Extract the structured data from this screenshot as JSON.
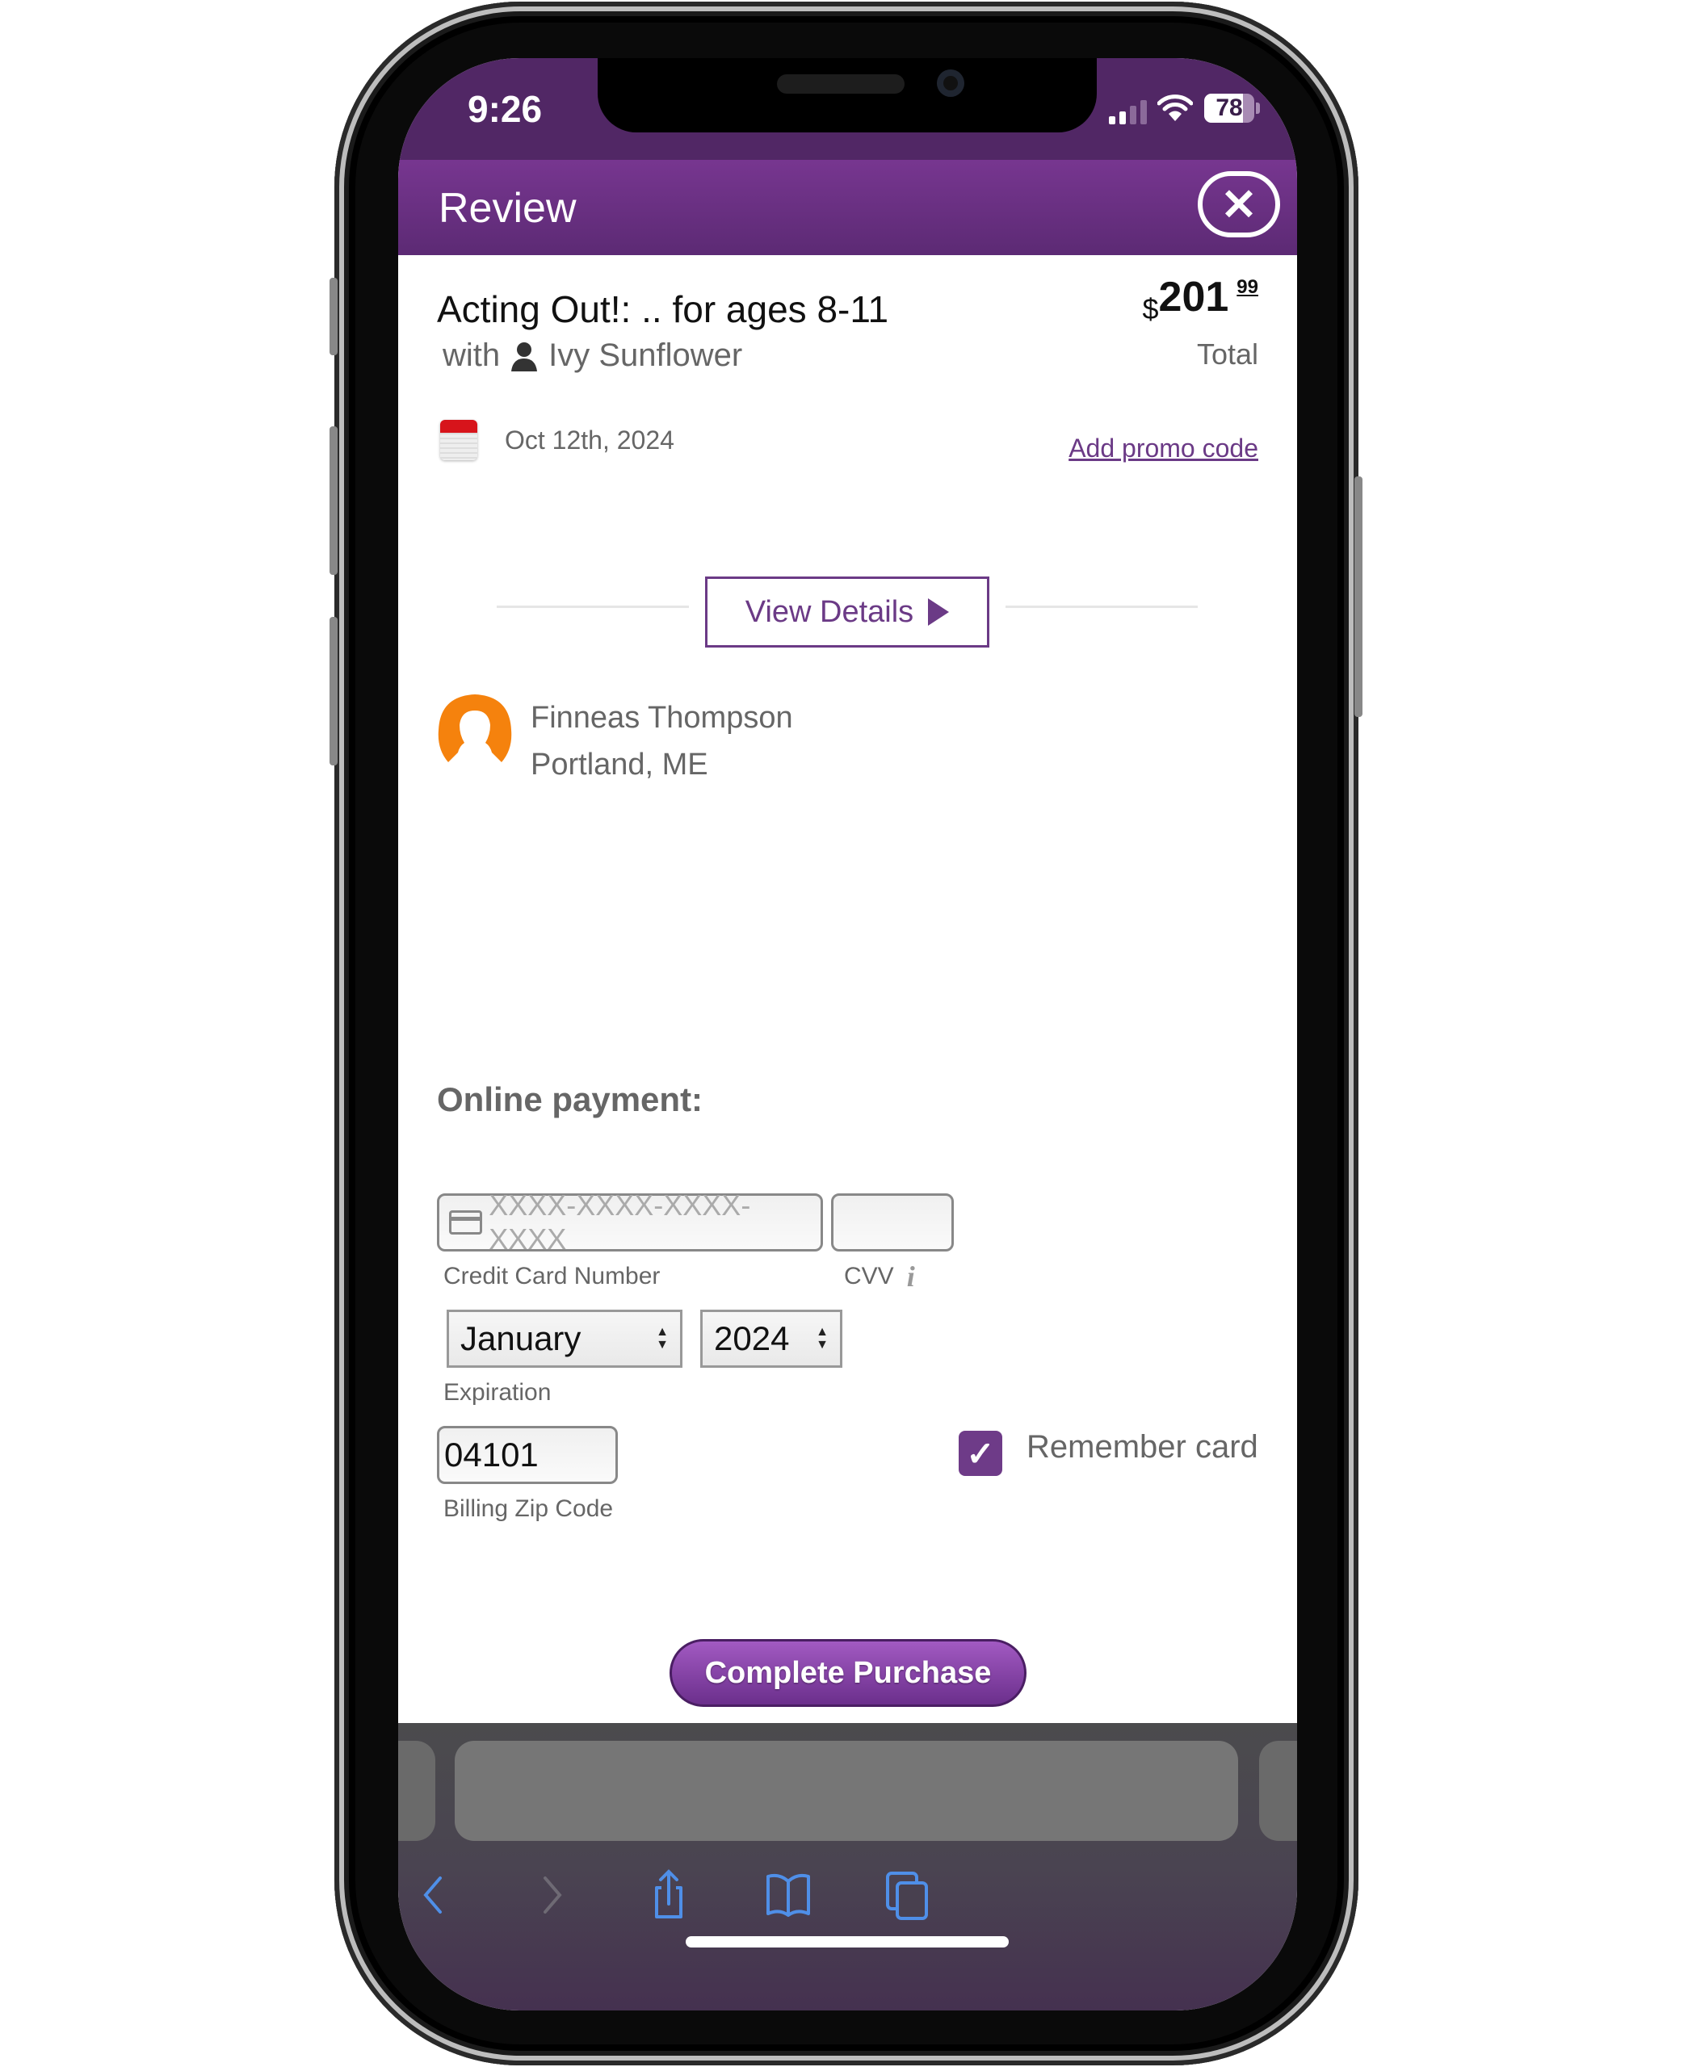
{
  "status_bar": {
    "time": "9:26",
    "battery_percent": "78",
    "battery_level": 0.78,
    "signal_bars": 2,
    "signal_bars_total": 4
  },
  "header": {
    "title": "Review",
    "close_icon": "close-icon"
  },
  "order": {
    "course_title": "Acting Out!: .. for ages 8-11",
    "with_label": "with",
    "instructor": "Ivy Sunflower",
    "price_currency": "$",
    "price_dollars": "201",
    "price_cents": "99",
    "total_label": "Total",
    "date": "Oct 12th, 2024",
    "promo_link": "Add promo code",
    "view_details_label": "View Details"
  },
  "student": {
    "name": "Finneas Thompson",
    "location": "Portland, ME"
  },
  "payment": {
    "title": "Online payment:",
    "card_number_placeholder": "XXXX-XXXX-XXXX-XXXX",
    "card_number_value": "",
    "card_number_label": "Credit Card Number",
    "cvv_value": "",
    "cvv_label": "CVV",
    "cvv_info_icon": "i",
    "expiration_month": "January",
    "expiration_year": "2024",
    "expiration_label": "Expiration",
    "zip_value": "04101",
    "zip_label": "Billing Zip Code",
    "remember_card_label": "Remember card",
    "remember_card_checked": true,
    "checkmark": "✓",
    "submit_label": "Complete Purchase"
  },
  "colors": {
    "brand_purple": "#6b3a86",
    "status_bar": "#512765",
    "avatar_orange": "#f5820d",
    "ios_blue": "#4f8fe8"
  },
  "safari_toolbar": {
    "icons": [
      "back-icon",
      "forward-icon",
      "share-icon",
      "bookmarks-icon",
      "tabs-icon"
    ]
  }
}
